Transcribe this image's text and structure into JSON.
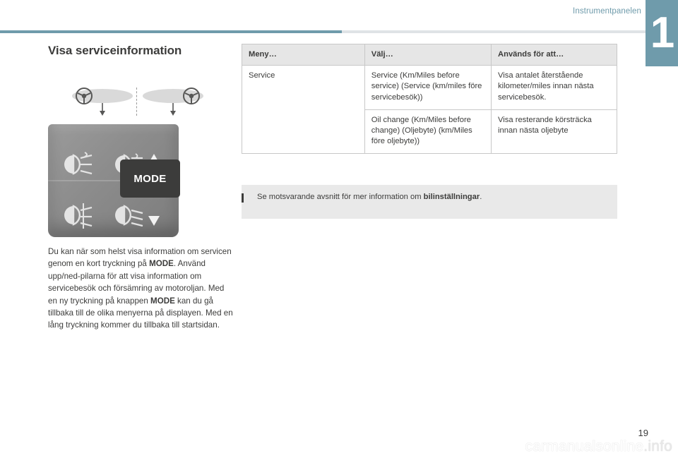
{
  "header": {
    "chapter_title": "Instrumentpanelen",
    "chapter_number": "1",
    "accent_color": "#6f9bab"
  },
  "left": {
    "section_title": "Visa serviceinformation",
    "mode_button_label": "MODE",
    "body_paragraph_1": "Du kan när som helst visa information om servicen genom en kort tryckning på ",
    "body_bold_1": "MODE",
    "body_paragraph_2": ". Använd upp/ned-pilarna för att visa information om servicebesök och försämring av motoroljan. Med en ny tryckning på knappen ",
    "body_bold_2": "MODE",
    "body_paragraph_3": " kan du gå tillbaka till de olika menyerna på displayen. Med en lång tryckning kommer du tillbaka till startsidan."
  },
  "table": {
    "headers": [
      "Meny…",
      "Välj…",
      "Används för att…"
    ],
    "rows": [
      {
        "menu": "Service",
        "select": "Service (Km/Miles before service) (Service (km/miles före servicebesök))",
        "use": "Visa antalet återstående kilometer/miles innan nästa servicebesök."
      },
      {
        "menu": "",
        "select": "Oil change (Km/Miles before change) (Oljebyte) (km/Miles före oljebyte))",
        "use": "Visa resterande körsträcka innan nästa oljebyte"
      }
    ]
  },
  "note": {
    "text_before": "Se motsvarande avsnitt för mer information om ",
    "text_bold": "bilinställningar",
    "text_after": "."
  },
  "footer": {
    "page_number": "19",
    "watermark_main": "carmanualsonline",
    "watermark_suffix": ".info"
  },
  "icons": {
    "front_fog_lamp": "front-fog-lamp-icon",
    "rear_fog_lamp": "rear-fog-lamp-icon",
    "headlight_up": "headlight-up-icon",
    "headlight_down": "headlight-down-icon",
    "steering_wheel_left": "steering-wheel-left-icon",
    "steering_wheel_right": "steering-wheel-right-icon"
  }
}
